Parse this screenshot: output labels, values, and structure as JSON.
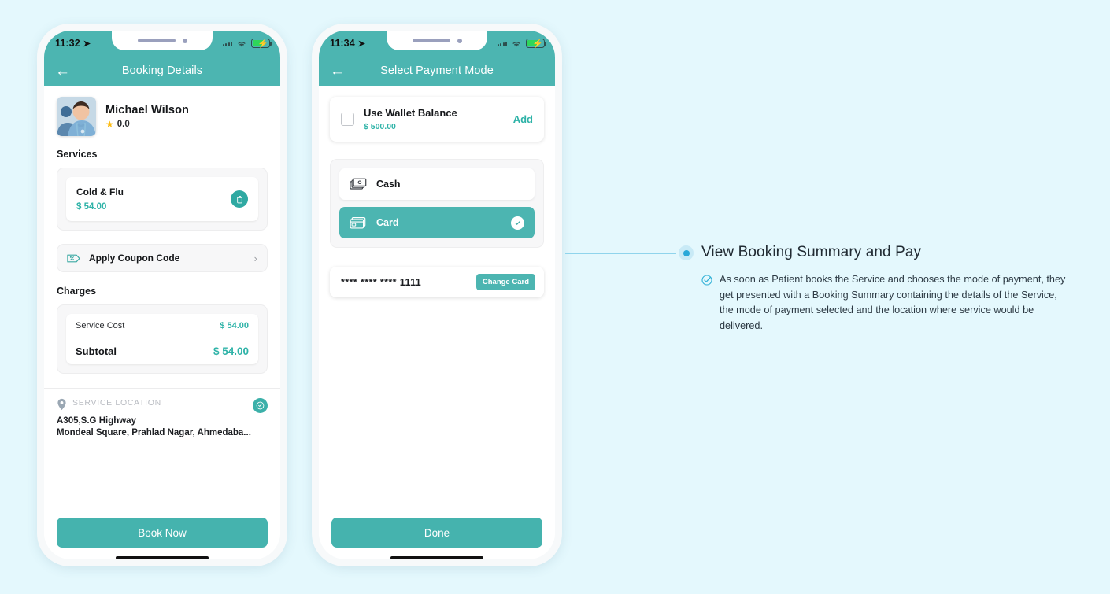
{
  "phone1": {
    "status": {
      "time": "11:32",
      "location_icon": "location-arrow-icon",
      "wifi_icon": "wifi-icon",
      "battery_icon": "battery-charging-icon"
    },
    "appbar": {
      "back_icon": "back-arrow-icon",
      "title": "Booking Details"
    },
    "doctor": {
      "name": "Michael Wilson",
      "rating": "0.0",
      "star_icon": "star-icon",
      "avatar": "doctor-avatar"
    },
    "services_heading": "Services",
    "service": {
      "name": "Cold & Flu",
      "price": "$ 54.00",
      "delete_icon": "delete-icon"
    },
    "coupon": {
      "label": "Apply Coupon Code",
      "icon": "coupon-tag-icon",
      "chevron": "›"
    },
    "charges_heading": "Charges",
    "charges": [
      {
        "label": "Service Cost",
        "value": "$ 54.00"
      },
      {
        "label": "Subtotal",
        "value": "$ 54.00"
      }
    ],
    "location": {
      "caption": "SERVICE LOCATION",
      "line1": "A305,S.G Highway",
      "line2": "Mondeal Square, Prahlad Nagar, Ahmedaba...",
      "pin_icon": "map-pin-icon",
      "edit_icon": "edit-location-icon"
    },
    "cta": "Book Now"
  },
  "phone2": {
    "status": {
      "time": "11:34",
      "location_icon": "location-arrow-icon",
      "wifi_icon": "wifi-icon",
      "battery_icon": "battery-charging-icon"
    },
    "appbar": {
      "back_icon": "back-arrow-icon",
      "title": "Select Payment Mode"
    },
    "wallet": {
      "title": "Use Wallet Balance",
      "balance": "$ 500.00",
      "add_label": "Add",
      "checkbox": "wallet-checkbox"
    },
    "payment_modes": [
      {
        "label": "Cash",
        "icon": "cash-icon",
        "selected": false
      },
      {
        "label": "Card",
        "icon": "credit-card-icon",
        "selected": true
      }
    ],
    "saved_card": {
      "number": "**** **** **** 1111",
      "change_label": "Change Card"
    },
    "cta": "Done"
  },
  "annotation": {
    "title": "View Booking Summary and Pay",
    "check_icon": "check-circle-icon",
    "text": "As soon as Patient books the Service and chooses the mode of payment, they get presented with a Booking Summary containing the details of the Service, the mode of payment selected and the location where service would be delivered."
  },
  "colors": {
    "teal": "#4cb5b1",
    "teal_text": "#2fb3a8",
    "background": "#e4f8fd",
    "accent_blue": "#29a8d8",
    "connector": "#8fd4ec",
    "star": "#fdbc11"
  }
}
